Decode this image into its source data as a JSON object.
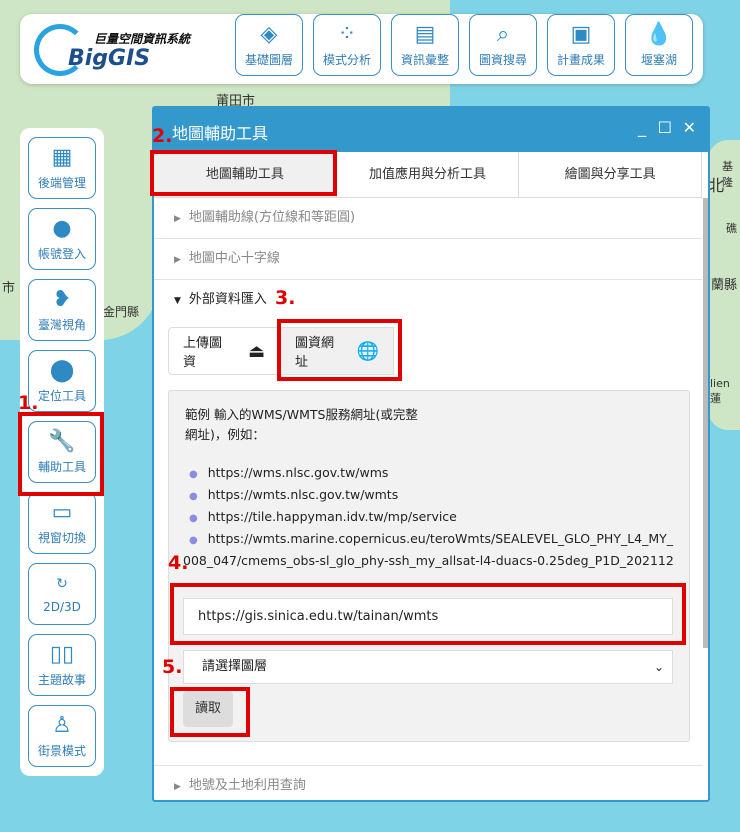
{
  "map": {
    "labels": [
      "莆田市",
      "金門縣",
      "市",
      "基隆",
      "北",
      "礁",
      "蘭縣",
      "lien",
      "蓮"
    ]
  },
  "topbar": {
    "logo_title": "巨量空間資訊系統",
    "logo_brand": "BigGIS",
    "buttons": [
      {
        "label": "基礎圖層",
        "icon": "layers-icon"
      },
      {
        "label": "模式分析",
        "icon": "bubbles-icon"
      },
      {
        "label": "資訊彙整",
        "icon": "file-location-icon"
      },
      {
        "label": "圖資搜尋",
        "icon": "search-layers-icon"
      },
      {
        "label": "計畫成果",
        "icon": "images-icon"
      },
      {
        "label": "堰塞湖",
        "icon": "water-drop-icon"
      }
    ]
  },
  "sidebar": {
    "items": [
      {
        "label": "後端管理",
        "icon": "dashboard-icon"
      },
      {
        "label": "帳號登入",
        "icon": "user-icon"
      },
      {
        "label": "臺灣視角",
        "icon": "taiwan-icon"
      },
      {
        "label": "定位工具",
        "icon": "location-pin-icon"
      },
      {
        "label": "輔助工具",
        "icon": "map-wrench-icon"
      },
      {
        "label": "視窗切換",
        "icon": "window-icon"
      },
      {
        "label": "2D/3D",
        "icon": "3d-rotate-icon"
      },
      {
        "label": "主題故事",
        "icon": "book-icon"
      },
      {
        "label": "街景模式",
        "icon": "street-view-icon"
      }
    ]
  },
  "panel": {
    "title": "地圖輔助工具",
    "tabs": [
      "地圖輔助工具",
      "加值應用與分析工具",
      "繪圖與分享工具"
    ],
    "rows": [
      "地圖輔助線(方位線和等距圓)",
      "地圖中心十字線",
      "外部資料匯入",
      "地號及土地利用查詢"
    ],
    "upload_label": "上傳圖資",
    "url_label": "圖資網址",
    "info_text": "範例 輸入的WMS/WMTS服務網址(或完整網址)，例如：",
    "examples": [
      "https://wms.nlsc.gov.tw/wms",
      "https://wmts.nlsc.gov.tw/wmts",
      "https://tile.happyman.idv.tw/mp/service",
      "https://wmts.marine.copernicus.eu/teroWmts/SEALEVEL_GLO_PHY_L4_MY_008_047/cmems_obs-sl_glo_phy-ssh_my_allsat-l4-duacs-0.25deg_P1D_202112"
    ],
    "url_value": "https://gis.sinica.edu.tw/tainan/wmts",
    "select_value": "請選擇圖層",
    "read_button": "讀取"
  },
  "annotations": [
    "1.",
    "2.",
    "3.",
    "4.",
    "5."
  ],
  "colors": {
    "accent": "#3399cc",
    "annotation": "#e00000"
  }
}
